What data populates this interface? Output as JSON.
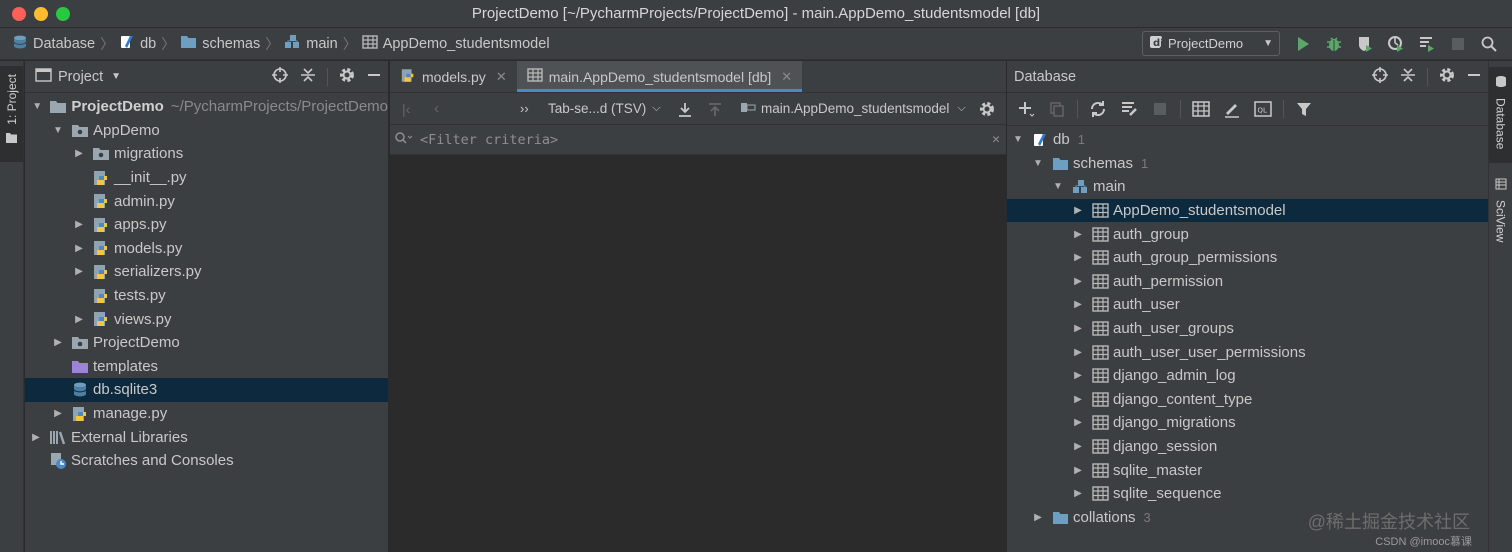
{
  "window": {
    "title": "ProjectDemo [~/PycharmProjects/ProjectDemo] - main.AppDemo_studentsmodel [db]"
  },
  "navbar": {
    "breadcrumbs": [
      "Database",
      "db",
      "schemas",
      "main",
      "AppDemo_studentsmodel"
    ],
    "run_config": "ProjectDemo"
  },
  "left_strip": {
    "project_tab": "1: Project"
  },
  "right_strip": {
    "database_tab": "Database",
    "sciview_tab": "SciView"
  },
  "project_panel": {
    "title": "Project",
    "tree": [
      {
        "label": "ProjectDemo",
        "path": "~/PycharmProjects/ProjectDemo"
      },
      {
        "label": "AppDemo"
      },
      {
        "label": "migrations"
      },
      {
        "label": "__init__.py"
      },
      {
        "label": "admin.py"
      },
      {
        "label": "apps.py"
      },
      {
        "label": "models.py"
      },
      {
        "label": "serializers.py"
      },
      {
        "label": "tests.py"
      },
      {
        "label": "views.py"
      },
      {
        "label": "ProjectDemo"
      },
      {
        "label": "templates"
      },
      {
        "label": "db.sqlite3"
      },
      {
        "label": "manage.py"
      },
      {
        "label": "External Libraries"
      },
      {
        "label": "Scratches and Consoles"
      }
    ]
  },
  "editor": {
    "tabs": [
      {
        "label": "models.py"
      },
      {
        "label": "main.AppDemo_studentsmodel [db]"
      }
    ],
    "toolbar": {
      "format": "Tab-se...d (TSV)",
      "table": "main.AppDemo_studentsmodel"
    },
    "filter_placeholder": "<Filter criteria>"
  },
  "database_panel": {
    "title": "Database",
    "tree": [
      {
        "label": "db",
        "count": "1"
      },
      {
        "label": "schemas",
        "count": "1"
      },
      {
        "label": "main"
      },
      {
        "label": "AppDemo_studentsmodel"
      },
      {
        "label": "auth_group"
      },
      {
        "label": "auth_group_permissions"
      },
      {
        "label": "auth_permission"
      },
      {
        "label": "auth_user"
      },
      {
        "label": "auth_user_groups"
      },
      {
        "label": "auth_user_user_permissions"
      },
      {
        "label": "django_admin_log"
      },
      {
        "label": "django_content_type"
      },
      {
        "label": "django_migrations"
      },
      {
        "label": "django_session"
      },
      {
        "label": "sqlite_master"
      },
      {
        "label": "sqlite_sequence"
      },
      {
        "label": "collations",
        "count": "3"
      }
    ]
  },
  "watermark": {
    "text": "@稀土掘金技术社区",
    "csdn": "CSDN @imooc慕课"
  },
  "colors": {
    "accent": "#4a88c7",
    "selection": "#0d293e",
    "folder": "#6e9fc1",
    "green": "#59a869",
    "background": "#2b2b2b",
    "panel": "#3c3f41"
  }
}
